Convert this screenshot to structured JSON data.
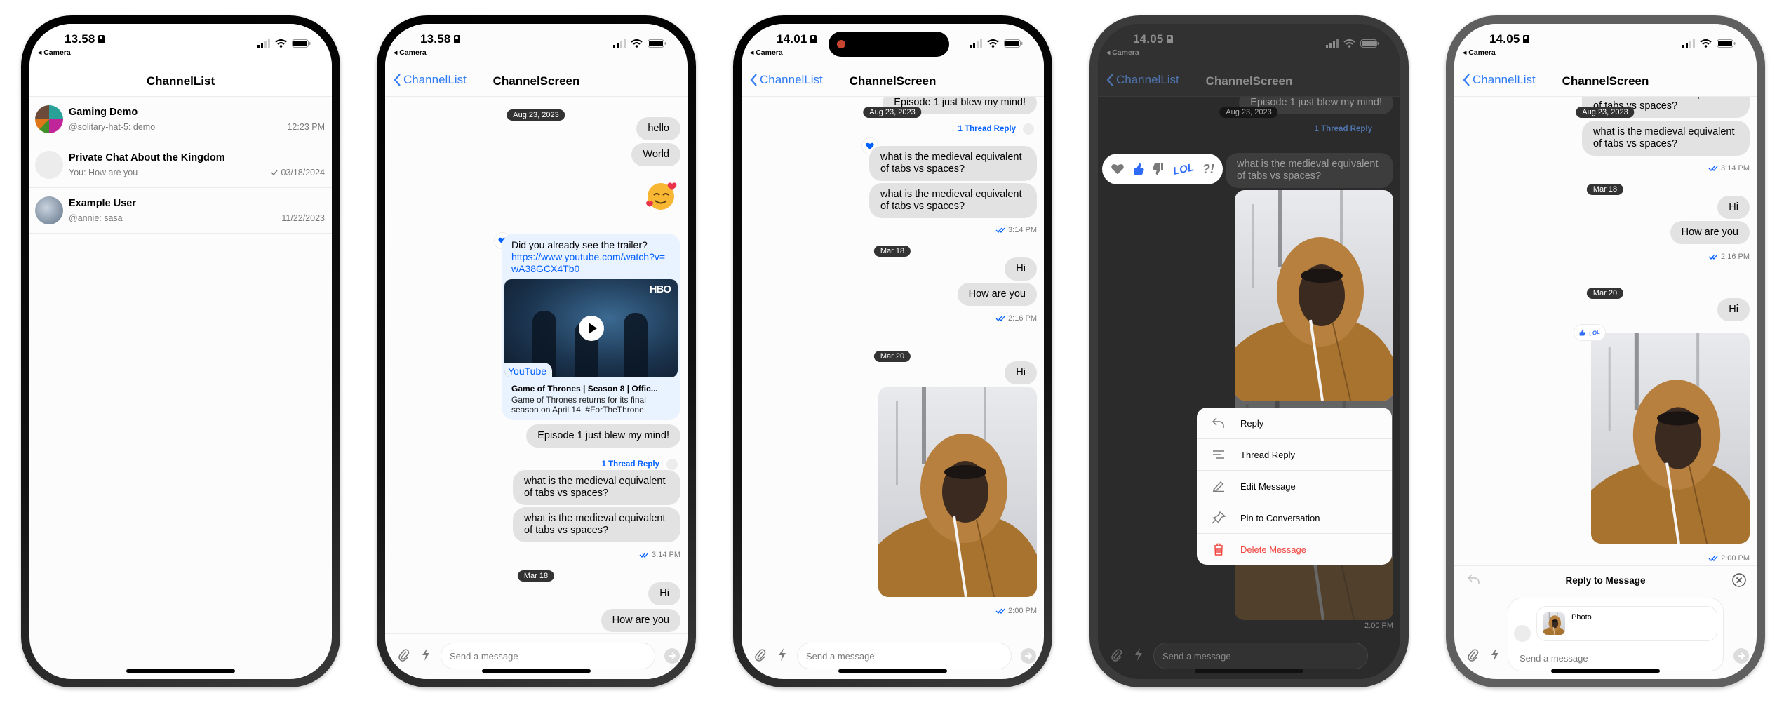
{
  "colors": {
    "accent": "#005fff",
    "bubble": "#e2e2e2",
    "link_bubble": "#e9f2ff",
    "delete": "#f0443f",
    "date_pill": "#333333"
  },
  "screens": [
    {
      "status": {
        "time": "13.58",
        "back_app": "Camera"
      },
      "header": {
        "title": "ChannelList"
      },
      "channels": [
        {
          "name": "Gaming Demo",
          "preview": "@solitary-hat-5: demo",
          "time": "12:23 PM"
        },
        {
          "name": "Private Chat About the Kingdom",
          "preview": "You: How are you",
          "time": "03/18/2024",
          "read_icon": "check-icon"
        },
        {
          "name": "Example User",
          "preview": "@annie: sasa",
          "time": "11/22/2023"
        }
      ]
    },
    {
      "status": {
        "time": "13.58",
        "back_app": "Camera"
      },
      "header": {
        "back": "ChannelList",
        "title": "ChannelScreen"
      },
      "messages": {
        "date1": "Aug 23, 2023",
        "m_hello": "hello",
        "m_world": "World",
        "emoji_icon": "smiling-face-with-hearts",
        "link": {
          "text": "Did you already see the trailer?",
          "url": "https://www.youtube.com/watch?v=wA38GCX4Tb0",
          "reaction": "heart",
          "preview": {
            "logo": "HBO",
            "source": "YouTube",
            "title": "Game of Thrones | Season 8 | Offic...",
            "description": "Game of Thrones returns for its final season on April 14. #ForTheThrone"
          }
        },
        "m_episode": "Episode 1 just blew my mind!",
        "thread_reply": "1 Thread Reply",
        "m_medieval": "what is the medieval equivalent of tabs vs spaces?",
        "time1": "3:14 PM",
        "date2": "Mar 18",
        "m_hi": "Hi",
        "m_how": "How are you"
      },
      "composer": {
        "placeholder": "Send a message"
      }
    },
    {
      "status": {
        "time": "14.01",
        "back_app": "Camera"
      },
      "header": {
        "back": "ChannelList",
        "title": "ChannelScreen"
      },
      "messages": {
        "date1": "Aug 23, 2023",
        "m_episode": "Episode 1 just blew my mind!",
        "thread_reply": "1 Thread Reply",
        "m_medieval": "what is the medieval equivalent of tabs vs spaces?",
        "time1": "3:14 PM",
        "date2": "Mar 18",
        "m_hi": "Hi",
        "m_how": "How are you",
        "time2": "2:16 PM",
        "date3": "Mar 20",
        "m_hi2": "Hi",
        "time3": "2:00 PM"
      },
      "composer": {
        "placeholder": "Send a message"
      }
    },
    {
      "status": {
        "time": "14.05",
        "back_app": "Camera"
      },
      "header": {
        "back": "ChannelList",
        "title": "ChannelScreen"
      },
      "messages": {
        "date1": "Aug 23, 2023",
        "m_episode": "Episode 1 just blew my mind!",
        "thread_reply": "1 Thread Reply",
        "m_medieval": "what is the medieval equivalent of tabs vs spaces?",
        "time3": "2:00 PM"
      },
      "reactions": [
        {
          "icon": "heart",
          "selected": false
        },
        {
          "icon": "thumbs-up",
          "selected": true
        },
        {
          "icon": "thumbs-down",
          "selected": false
        },
        {
          "icon": "lol",
          "label": "LOL",
          "selected": true
        },
        {
          "icon": "wut",
          "label": "?!",
          "selected": false
        }
      ],
      "menu": [
        {
          "icon": "reply",
          "label": "Reply"
        },
        {
          "icon": "thread-reply",
          "label": "Thread Reply"
        },
        {
          "icon": "edit",
          "label": "Edit Message"
        },
        {
          "icon": "pin",
          "label": "Pin to Conversation"
        },
        {
          "icon": "trash",
          "label": "Delete Message",
          "destructive": true
        }
      ],
      "composer": {
        "placeholder": "Send a message"
      }
    },
    {
      "status": {
        "time": "14.05",
        "back_app": "Camera"
      },
      "header": {
        "back": "ChannelList",
        "title": "ChannelScreen"
      },
      "messages": {
        "date1": "Aug 23, 2023",
        "m_medieval": "what is the medieval equivalent of tabs vs spaces?",
        "time1": "3:14 PM",
        "date2": "Mar 18",
        "m_hi": "Hi",
        "m_how": "How are you",
        "time2": "2:16 PM",
        "date3": "Mar 20",
        "m_hi2": "Hi",
        "photo_reactions": [
          "thumbs-up",
          "LOL"
        ],
        "time3": "2:00 PM"
      },
      "reply": {
        "title": "Reply to Message",
        "quoted": "Photo"
      },
      "composer": {
        "placeholder": "Send a message"
      }
    }
  ]
}
